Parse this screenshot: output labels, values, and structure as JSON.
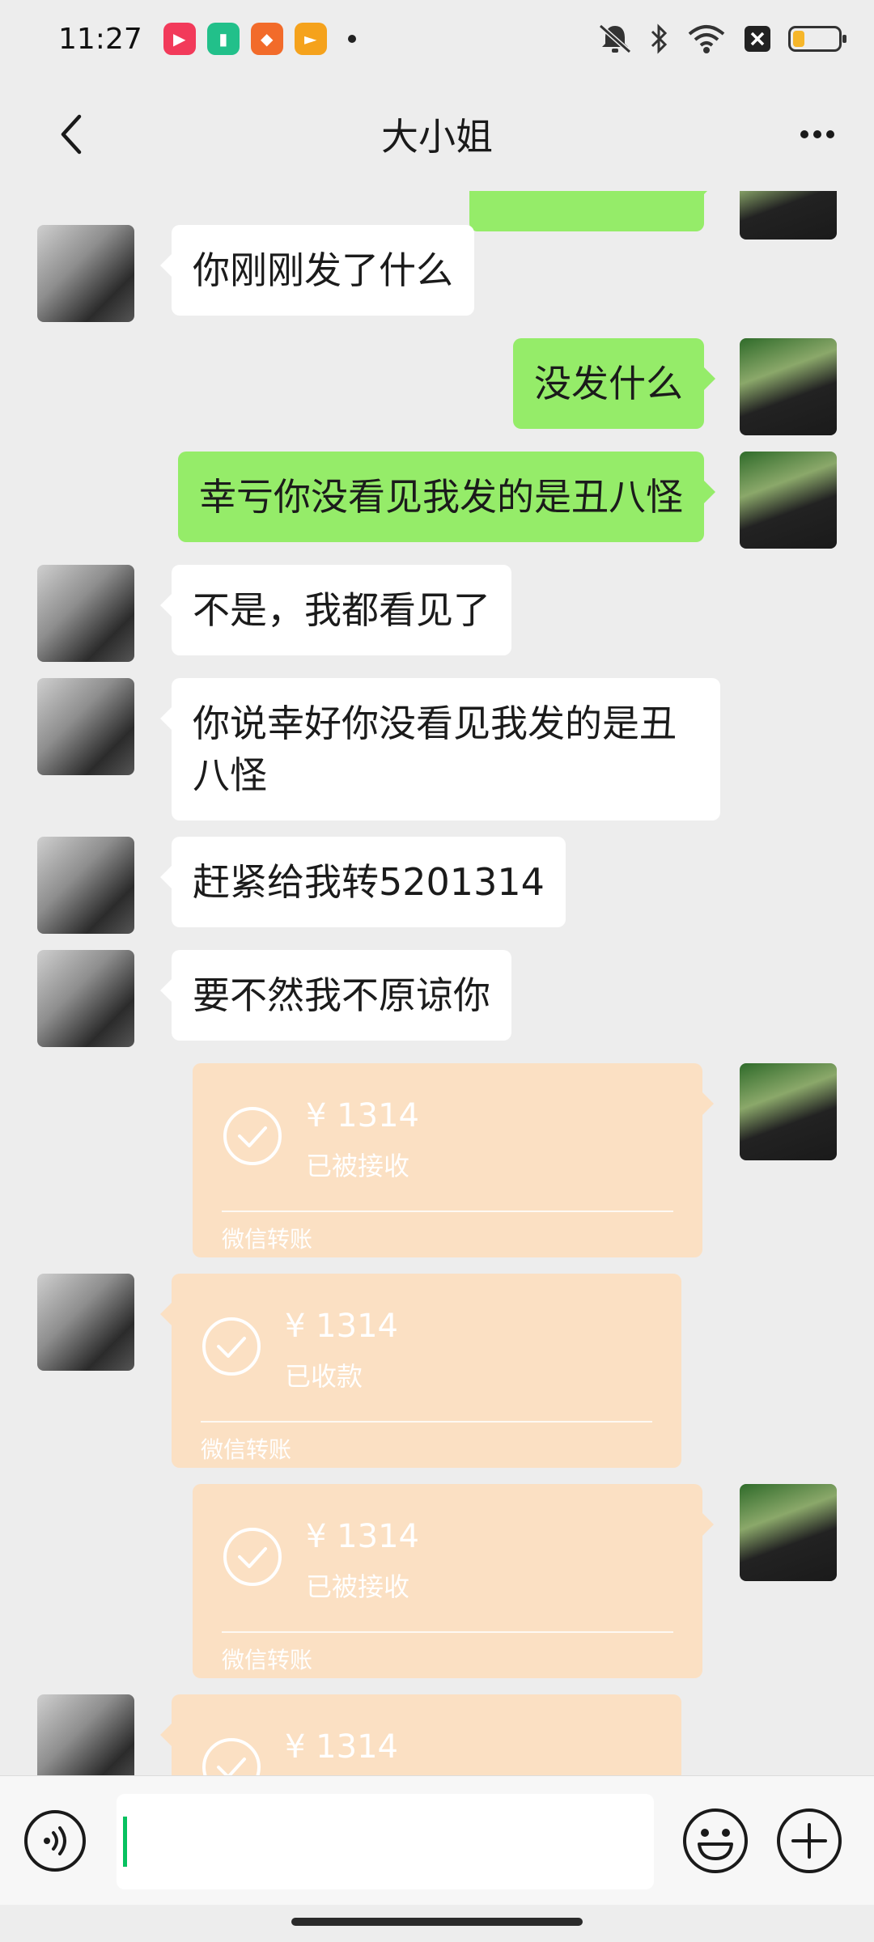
{
  "status_bar": {
    "time": "11:27",
    "icons": [
      "play-app-icon",
      "battery-app-icon",
      "shopping-app-icon",
      "video-app-icon",
      "mute-icon",
      "bluetooth-icon",
      "wifi-icon",
      "sim-off-icon"
    ],
    "battery_level": 0.25
  },
  "header": {
    "title": "大小姐",
    "back_icon": "chevron-left-icon",
    "more_icon": "more-dots-icon"
  },
  "messages": [
    {
      "side": "left",
      "type": "text",
      "text": "你刚刚发了什么"
    },
    {
      "side": "right",
      "type": "text",
      "text": "没发什么"
    },
    {
      "side": "right",
      "type": "text",
      "text": "幸亏你没看见我发的是丑八怪"
    },
    {
      "side": "left",
      "type": "text",
      "text": "不是，我都看见了"
    },
    {
      "side": "left",
      "type": "text",
      "text": "你说幸好你没看见我发的是丑八怪"
    },
    {
      "side": "left",
      "type": "text",
      "text": "赶紧给我转5201314"
    },
    {
      "side": "left",
      "type": "text",
      "text": "要不然我不原谅你"
    },
    {
      "side": "right",
      "type": "transfer",
      "amount": "¥ 1314",
      "status": "已被接收",
      "footer": "微信转账"
    },
    {
      "side": "left",
      "type": "transfer",
      "amount": "¥ 1314",
      "status": "已收款",
      "footer": "微信转账"
    },
    {
      "side": "right",
      "type": "transfer",
      "amount": "¥ 1314",
      "status": "已被接收",
      "footer": "微信转账"
    },
    {
      "side": "left",
      "type": "transfer",
      "amount": "¥ 1314",
      "status": "",
      "footer": ""
    }
  ],
  "input_bar": {
    "voice_icon": "voice-icon",
    "emoji_icon": "emoji-icon",
    "plus_icon": "plus-icon",
    "value": ""
  },
  "colors": {
    "background": "#ededed",
    "bubble_green": "#95ec69",
    "bubble_white": "#ffffff",
    "transfer": "#fbe0c3",
    "caret": "#07c160"
  }
}
